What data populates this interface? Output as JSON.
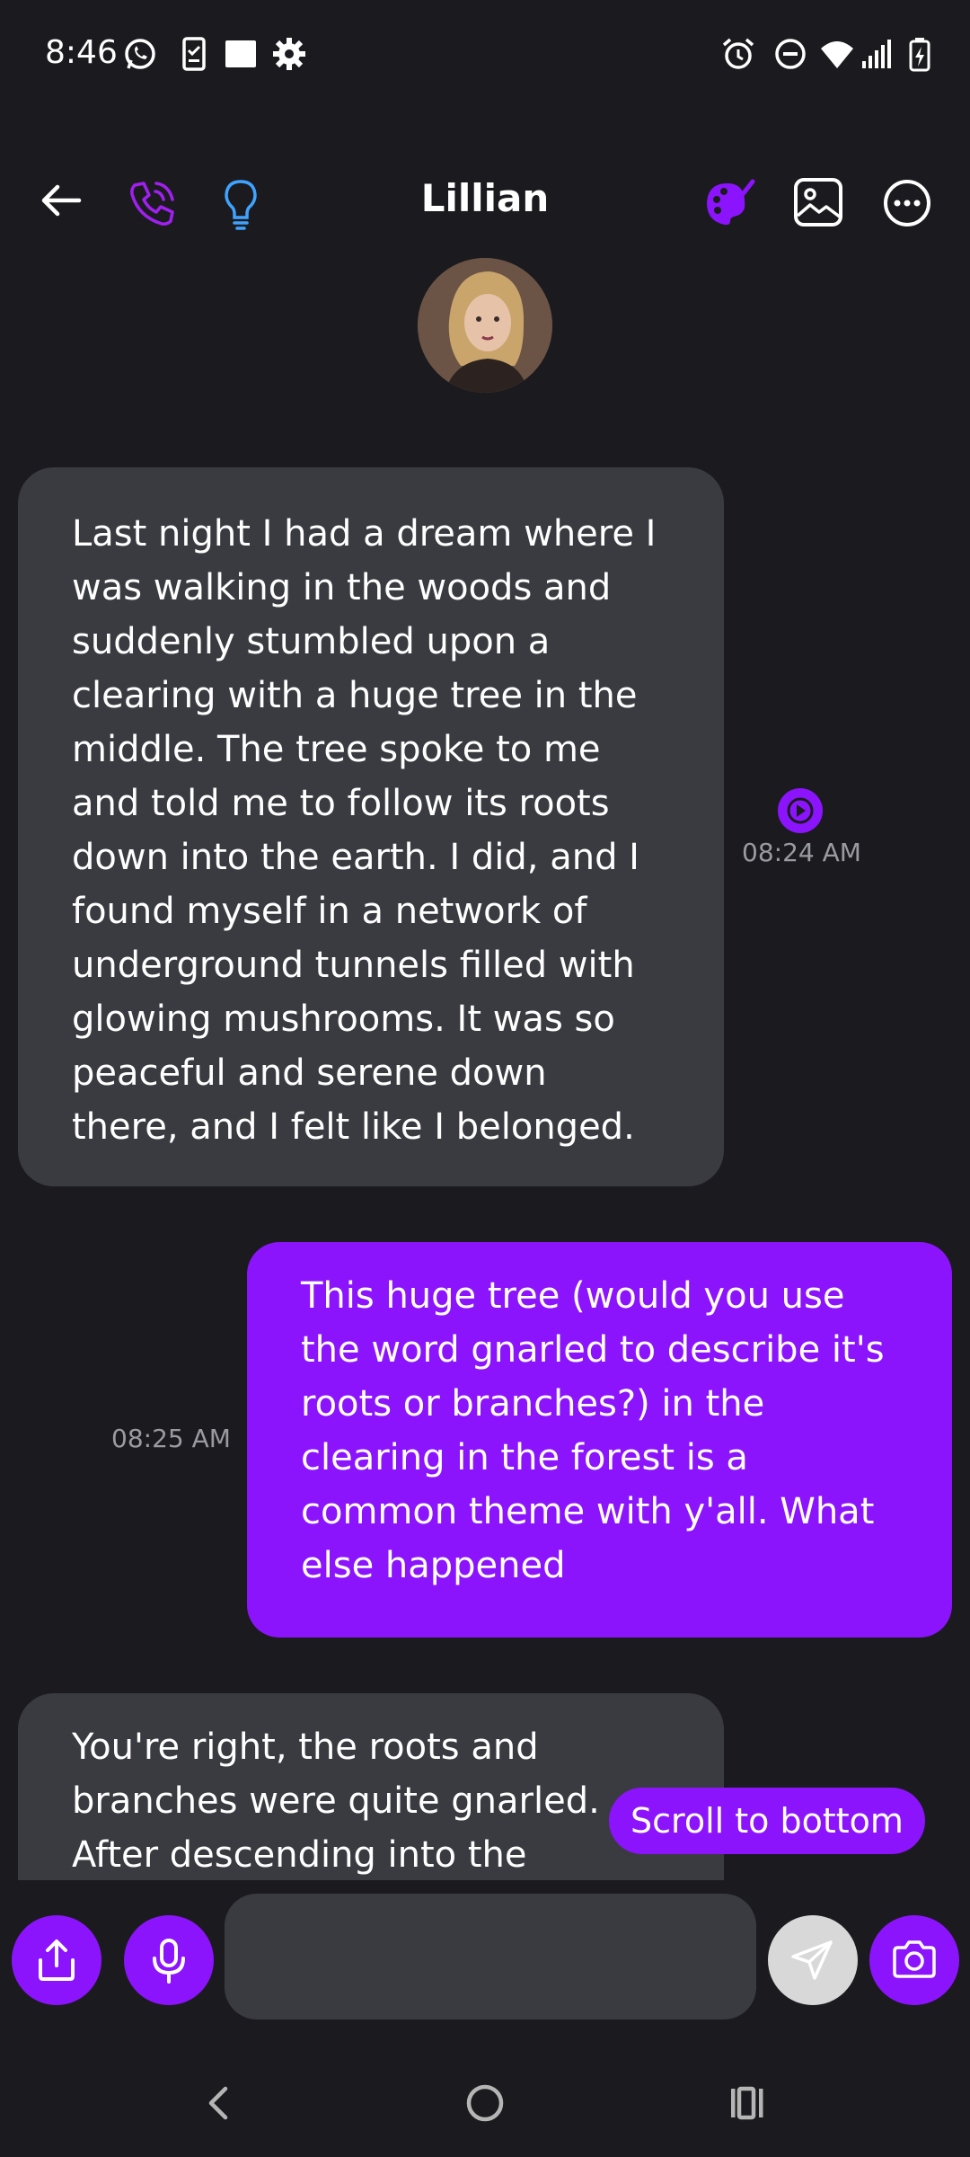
{
  "status_bar": {
    "time": "8:46",
    "icons": [
      "whatsapp-icon",
      "phone-checklist-icon",
      "square-icon",
      "settings-icon",
      "alarm-icon",
      "do-not-disturb-icon",
      "wifi-icon",
      "signal-icon",
      "battery-charging-icon"
    ]
  },
  "header": {
    "contact_name": "Lillian",
    "accent_color": "#8c14fc",
    "idea_color": "#3fa3ff"
  },
  "messages": [
    {
      "direction": "incoming",
      "text": "Last night I had a dream where I\nwas walking in the woods and\nsuddenly stumbled upon a\nclearing with a huge tree in the\nmiddle. The tree spoke to me\nand told me to follow its roots\ndown into the earth. I did, and I\nfound myself in a network of\nunderground tunnels filled with\nglowing mushrooms. It was so\npeaceful and serene down\nthere, and I felt like I belonged.",
      "time": "08:24 AM",
      "has_audio": true
    },
    {
      "direction": "outgoing",
      "text": "This huge tree (would you use\nthe word gnarled to describe it's\nroots or branches?) in the\nclearing in the forest is a\ncommon theme with y'all. What\nelse happened",
      "time": "08:25 AM"
    },
    {
      "direction": "incoming",
      "text": "You're right, the roots and\nbranches were quite gnarled.\nAfter descending into the",
      "time": ""
    }
  ],
  "scroll_to_bottom_label": "Scroll to bottom",
  "composer": {
    "placeholder": ""
  },
  "colors": {
    "background": "#1b1b1f",
    "incoming_bubble": "#3a3b41",
    "outgoing_bubble": "#8c14fc",
    "timestamp": "#9a9aa1"
  }
}
